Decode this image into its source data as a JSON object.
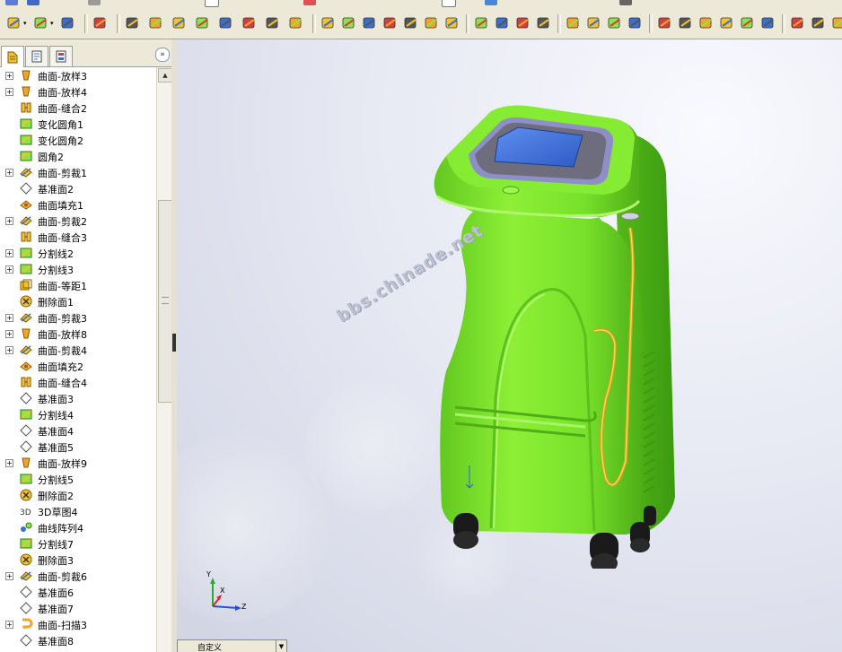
{
  "tree": {
    "items": [
      {
        "label": "曲面-放样3",
        "icon": "loft-surface-icon",
        "expandable": true
      },
      {
        "label": "曲面-放样4",
        "icon": "loft-surface-icon",
        "expandable": true
      },
      {
        "label": "曲面-缝合2",
        "icon": "knit-surface-icon",
        "expandable": false
      },
      {
        "label": "变化圆角1",
        "icon": "variable-fillet-icon",
        "expandable": false
      },
      {
        "label": "变化圆角2",
        "icon": "variable-fillet-icon",
        "expandable": false
      },
      {
        "label": "圆角2",
        "icon": "fillet-icon",
        "expandable": false
      },
      {
        "label": "曲面-剪裁1",
        "icon": "trim-surface-icon",
        "expandable": true
      },
      {
        "label": "基准面2",
        "icon": "plane-icon",
        "expandable": false
      },
      {
        "label": "曲面填充1",
        "icon": "fill-surface-icon",
        "expandable": false
      },
      {
        "label": "曲面-剪裁2",
        "icon": "trim-surface-icon",
        "expandable": true
      },
      {
        "label": "曲面-缝合3",
        "icon": "knit-surface-icon",
        "expandable": false
      },
      {
        "label": "分割线2",
        "icon": "split-line-icon",
        "expandable": true
      },
      {
        "label": "分割线3",
        "icon": "split-line-icon",
        "expandable": true
      },
      {
        "label": "曲面-等距1",
        "icon": "offset-surface-icon",
        "expandable": false
      },
      {
        "label": "删除面1",
        "icon": "delete-face-icon",
        "expandable": false
      },
      {
        "label": "曲面-剪裁3",
        "icon": "trim-surface-icon",
        "expandable": true
      },
      {
        "label": "曲面-放样8",
        "icon": "loft-surface-icon",
        "expandable": true
      },
      {
        "label": "曲面-剪裁4",
        "icon": "trim-surface-icon",
        "expandable": true
      },
      {
        "label": "曲面填充2",
        "icon": "fill-surface-icon",
        "expandable": false
      },
      {
        "label": "曲面-缝合4",
        "icon": "knit-surface-icon",
        "expandable": false
      },
      {
        "label": "基准面3",
        "icon": "plane-icon",
        "expandable": false
      },
      {
        "label": "分割线4",
        "icon": "split-line-icon",
        "expandable": false
      },
      {
        "label": "基准面4",
        "icon": "plane-icon",
        "expandable": false
      },
      {
        "label": "基准面5",
        "icon": "plane-icon",
        "expandable": false
      },
      {
        "label": "曲面-放样9",
        "icon": "loft-surface-icon",
        "expandable": true
      },
      {
        "label": "分割线5",
        "icon": "split-line-icon",
        "expandable": false
      },
      {
        "label": "删除面2",
        "icon": "delete-face-icon",
        "expandable": false
      },
      {
        "label": "3D草图4",
        "icon": "sketch-3d-icon",
        "expandable": false
      },
      {
        "label": "曲线阵列4",
        "icon": "curve-pattern-icon",
        "expandable": false
      },
      {
        "label": "分割线7",
        "icon": "split-line-icon",
        "expandable": false
      },
      {
        "label": "删除面3",
        "icon": "delete-face-icon",
        "expandable": false
      },
      {
        "label": "曲面-剪裁6",
        "icon": "trim-surface-icon",
        "expandable": true
      },
      {
        "label": "基准面6",
        "icon": "plane-icon",
        "expandable": false
      },
      {
        "label": "基准面7",
        "icon": "plane-icon",
        "expandable": false
      },
      {
        "label": "曲面-扫描3",
        "icon": "sweep-surface-icon",
        "expandable": true
      },
      {
        "label": "基准面8",
        "icon": "plane-icon",
        "expandable": false
      }
    ]
  },
  "viewport": {
    "watermark": "bbs.chinade.net",
    "axes": {
      "x": "X",
      "y": "Y",
      "z": "Z"
    },
    "config_label": "自定义"
  },
  "toolbar": {
    "icons": [
      "units-icon",
      "view-orientation-icon",
      "axis-icon",
      "feature-icon",
      "rib-icon",
      "mirror-icon",
      "wrap-icon",
      "dome-icon",
      "deform-icon",
      "loft-icon",
      "thicken-icon",
      "shell-icon",
      "extrude-surface-icon",
      "revolve-surface-icon",
      "sweep-icon",
      "loft-surface-icon",
      "boundary-icon",
      "fill-icon",
      "offset-icon",
      "knit-icon",
      "trim-icon",
      "extend-icon",
      "untrim-icon",
      "delete-face-icon",
      "replace-face-icon",
      "pattern-icon",
      "curve-icon",
      "split-line-icon",
      "project-curve-icon",
      "composite-curve-icon",
      "helix-icon",
      "3d-sketch-icon",
      "smart-dimension-icon",
      "sketch-icon",
      "tools-icon",
      "options-icon",
      "zoom-icon"
    ]
  },
  "colors": {
    "body_green": "#7de32e",
    "screen_blue": "#3d6ed6",
    "bezel": "#6b6b7d",
    "hose": "#c4a419",
    "wheel": "#1a1a1a"
  }
}
